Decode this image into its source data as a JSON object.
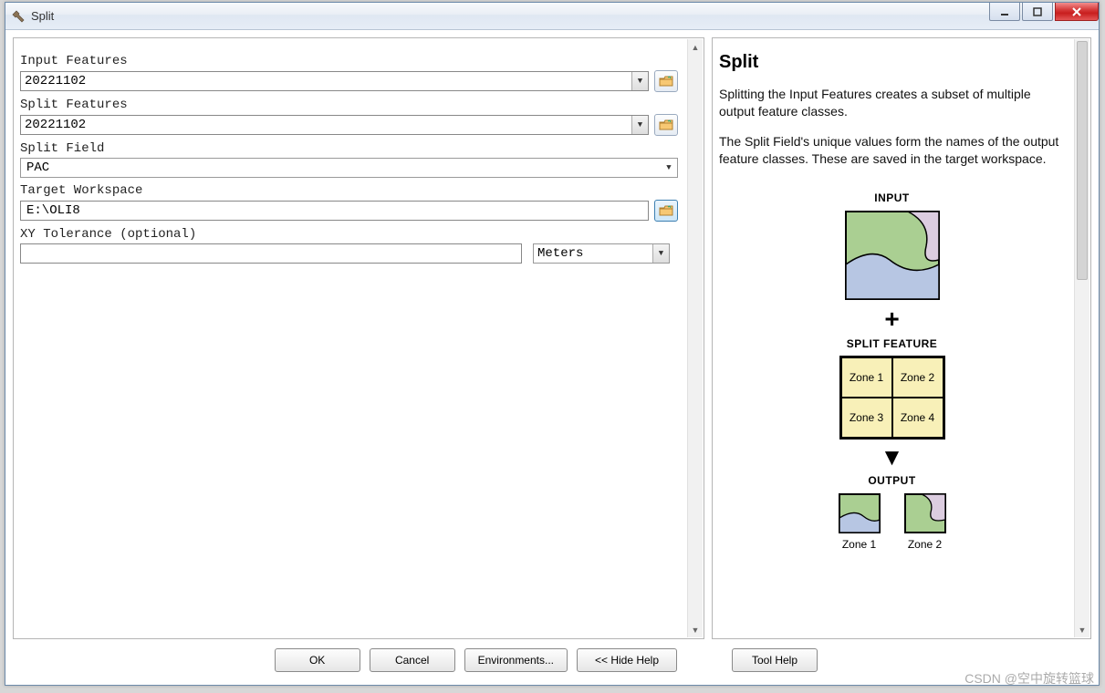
{
  "window": {
    "title": "Split"
  },
  "form": {
    "input_features": {
      "label": "Input Features",
      "value": "20221102"
    },
    "split_features": {
      "label": "Split Features",
      "value": "20221102"
    },
    "split_field": {
      "label": "Split Field",
      "value": "PAC"
    },
    "target_workspace": {
      "label": "Target Workspace",
      "value": "E:\\OLI8"
    },
    "xy_tolerance": {
      "label": "XY Tolerance (optional)",
      "value": "",
      "unit": "Meters"
    }
  },
  "help": {
    "title": "Split",
    "p1": "Splitting the Input Features creates a subset of multiple output feature classes.",
    "p2": "The Split Field's unique values form the names of the output feature classes. These are saved in the target workspace.",
    "diag": {
      "input": "INPUT",
      "split_feature": "SPLIT FEATURE",
      "zones": [
        "Zone 1",
        "Zone 2",
        "Zone 3",
        "Zone 4"
      ],
      "output": "OUTPUT",
      "out_zones": [
        "Zone 1",
        "Zone 2"
      ]
    }
  },
  "buttons": {
    "ok": "OK",
    "cancel": "Cancel",
    "environments": "Environments...",
    "hide_help": "<< Hide Help",
    "tool_help": "Tool Help"
  },
  "watermark": "CSDN @空中旋转篮球"
}
